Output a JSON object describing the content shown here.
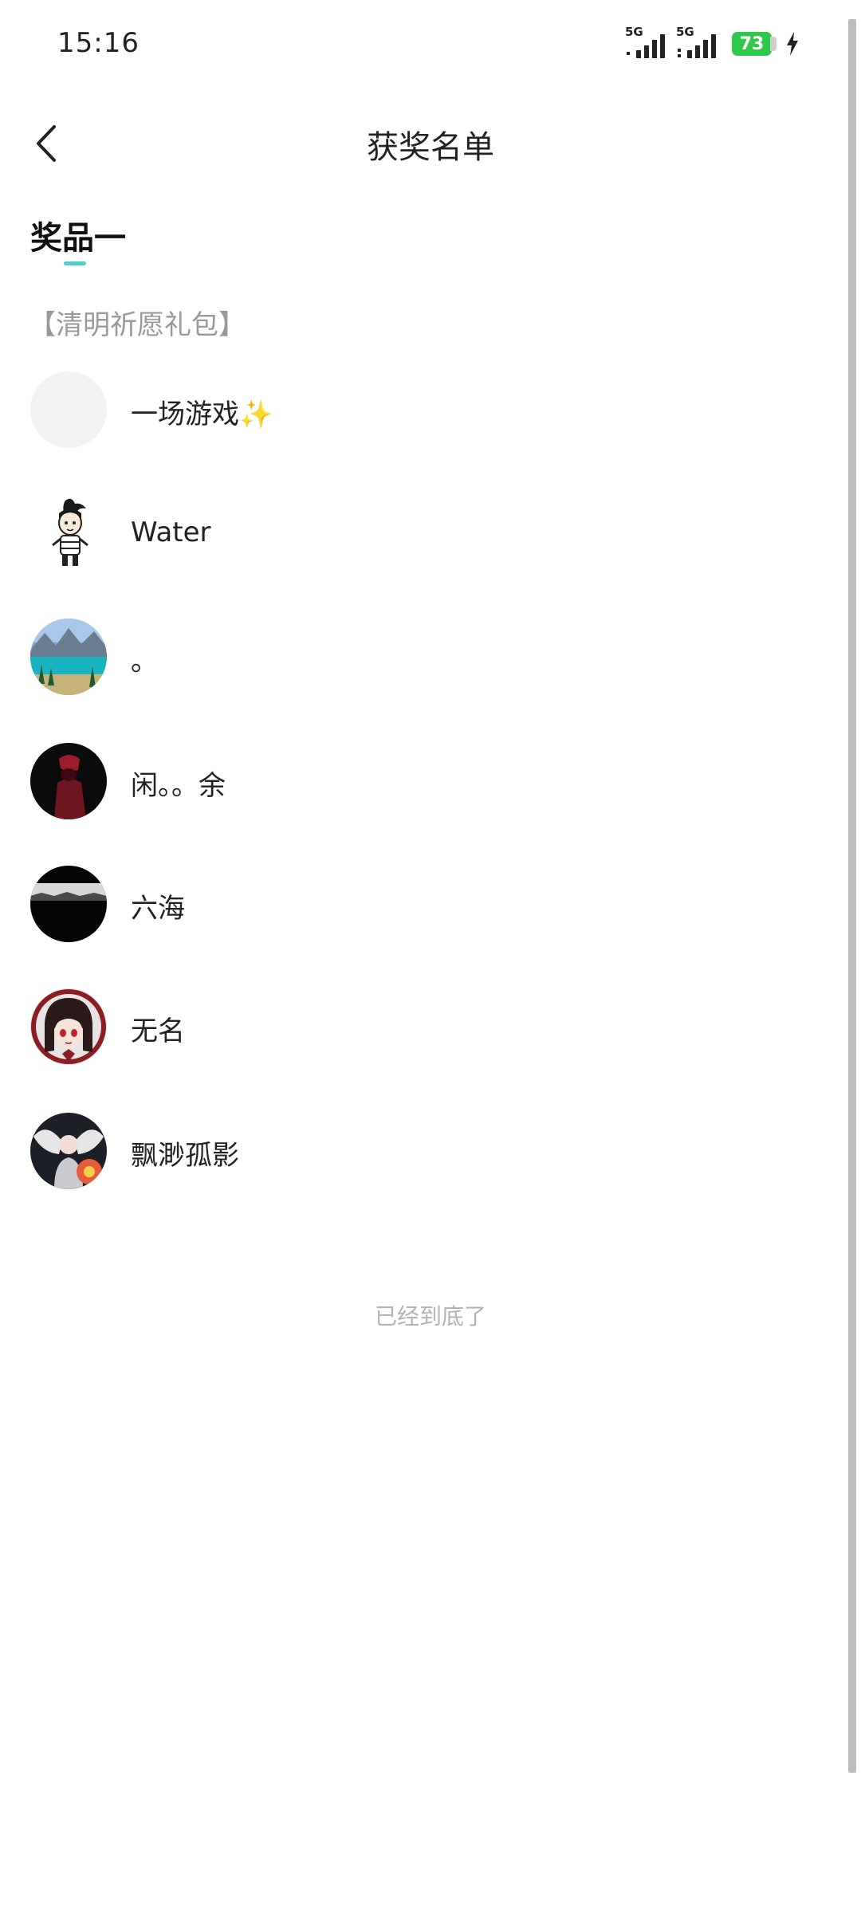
{
  "status_bar": {
    "time": "15:16",
    "network_1": "5G",
    "network_2": "5G",
    "battery_level": "73",
    "charging": true,
    "icons": [
      "signal-icon",
      "signal-icon",
      "battery-icon",
      "charging-icon"
    ]
  },
  "header": {
    "title": "获奖名单",
    "back_icon": "chevron-left-icon"
  },
  "tabs": [
    {
      "label": "奖品一",
      "active": true
    }
  ],
  "prize": {
    "name": "【清明祈愿礼包】"
  },
  "winners": [
    {
      "name": "一场游戏✨",
      "avatar": "blank"
    },
    {
      "name": "Water",
      "avatar": "cartoon-character"
    },
    {
      "name": "。",
      "avatar": "lake-landscape"
    },
    {
      "name": "闲。。余",
      "avatar": "dark-figure"
    },
    {
      "name": "六海",
      "avatar": "dark-horizon"
    },
    {
      "name": "无名",
      "avatar": "anime-girl"
    },
    {
      "name": "飘渺孤影",
      "avatar": "winged-figure"
    }
  ],
  "footer": {
    "end_text": "已经到底了"
  },
  "colors": {
    "accent": "#4fd1c5",
    "battery": "#2ec84a",
    "muted_text": "#999999",
    "end_text": "#b3b3b3"
  }
}
